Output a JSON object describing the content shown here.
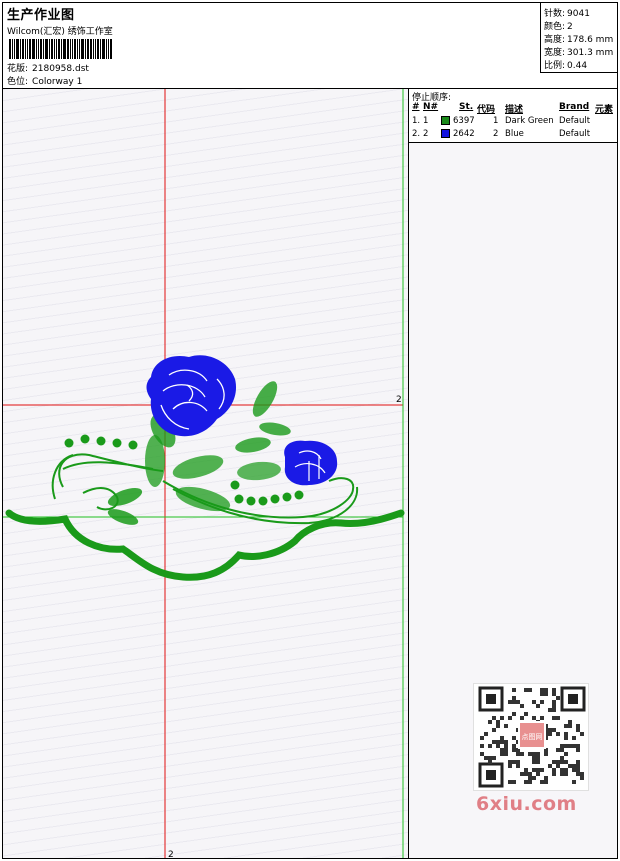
{
  "header": {
    "title": "生产作业图",
    "subtitle": "Wilcom(汇宏) 绣饰工作室",
    "pattern_label": "花版:",
    "pattern_value": "2180958.dst",
    "colorway_label": "色位:",
    "colorway_value": "Colorway 1"
  },
  "stats": {
    "stitches_label": "针数:",
    "stitches_value": "9041",
    "colors_label": "颜色:",
    "colors_value": "2",
    "height_label": "高度:",
    "height_value": "178.6 mm",
    "width_label": "宽度:",
    "width_value": "301.3 mm",
    "scale_label": "比例:",
    "scale_value": "0.44"
  },
  "panel": {
    "heading": "停止顺序:",
    "columns": [
      "#",
      "N#",
      "St.",
      "代码",
      "描述",
      "Brand",
      "元素"
    ],
    "rows": [
      {
        "index": "1.",
        "needle": "1",
        "color": "#1a8a1a",
        "stitches": "6397",
        "code": "1",
        "desc": "Dark Green",
        "brand": "Default"
      },
      {
        "index": "2.",
        "needle": "2",
        "color": "#1414e0",
        "stitches": "2642",
        "code": "2",
        "desc": "Blue",
        "brand": "Default"
      }
    ]
  },
  "guides": {
    "marker_right": "2",
    "marker_bottom": "2"
  },
  "colors": {
    "green_thread": "#1a9a1a",
    "blue_thread": "#1a1ae6",
    "guide_red": "#e01010",
    "guide_green": "#20c020"
  },
  "watermark": {
    "text": "6xiu.com",
    "stamp": "点图网"
  }
}
